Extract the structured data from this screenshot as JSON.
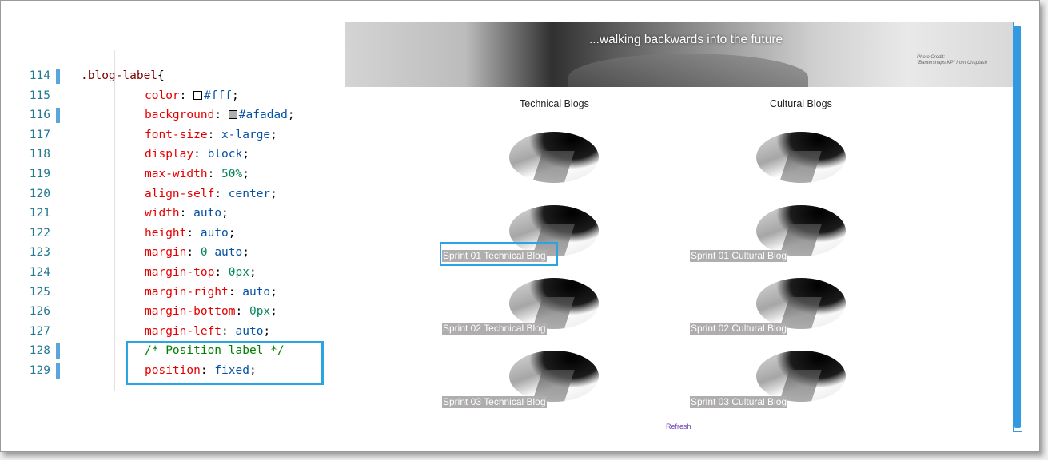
{
  "editor": {
    "colors": {
      "selector": "#800000",
      "property": "#e50000",
      "value": "#0451a5",
      "number": "#098658",
      "comment": "#008000",
      "line_number": "#237893",
      "gutter_mark": "#5aa5dc"
    },
    "lines": [
      {
        "num": "114",
        "selector": ".blog-label",
        "open": "{"
      },
      {
        "num": "115",
        "prop": "color",
        "swatch": "#ffffff",
        "value": "#fff"
      },
      {
        "num": "116",
        "prop": "background",
        "swatch": "#afadad",
        "value": "#afadad"
      },
      {
        "num": "117",
        "prop": "font-size",
        "value": "x-large"
      },
      {
        "num": "118",
        "prop": "display",
        "value": "block"
      },
      {
        "num": "119",
        "prop": "max-width",
        "value": "50%"
      },
      {
        "num": "120",
        "prop": "align-self",
        "value": "center"
      },
      {
        "num": "121",
        "prop": "width",
        "value": "auto"
      },
      {
        "num": "122",
        "prop": "height",
        "value": "auto"
      },
      {
        "num": "123",
        "prop": "margin",
        "value": "0 auto"
      },
      {
        "num": "124",
        "prop": "margin-top",
        "value": "0px"
      },
      {
        "num": "125",
        "prop": "margin-right",
        "value": "auto"
      },
      {
        "num": "126",
        "prop": "margin-bottom",
        "value": "0px"
      },
      {
        "num": "127",
        "prop": "margin-left",
        "value": "auto"
      },
      {
        "num": "128",
        "comment": "/* Position label */"
      },
      {
        "num": "129",
        "prop": "position",
        "value": "fixed"
      }
    ]
  },
  "preview": {
    "banner_title": "...walking backwards into the future",
    "banner_credit_line1": "Photo Credit:",
    "banner_credit_line2": "\"Bantersnaps KP\" from Unsplash",
    "technical_heading": "Technical Blogs",
    "cultural_heading": "Cultural Blogs",
    "technical_labels": [
      "Sprint 01 Technical Blog",
      "Sprint 02 Technical Blog",
      "Sprint 03 Technical Blog"
    ],
    "cultural_labels": [
      "Sprint 01 Cultural Blog",
      "Sprint 02 Cultural Blog",
      "Sprint 03 Cultural Blog"
    ],
    "refresh_label": "Refresh",
    "label_background": "#afadad",
    "highlight_color": "#2aa4e3",
    "link_color": "#6a3fb0"
  }
}
